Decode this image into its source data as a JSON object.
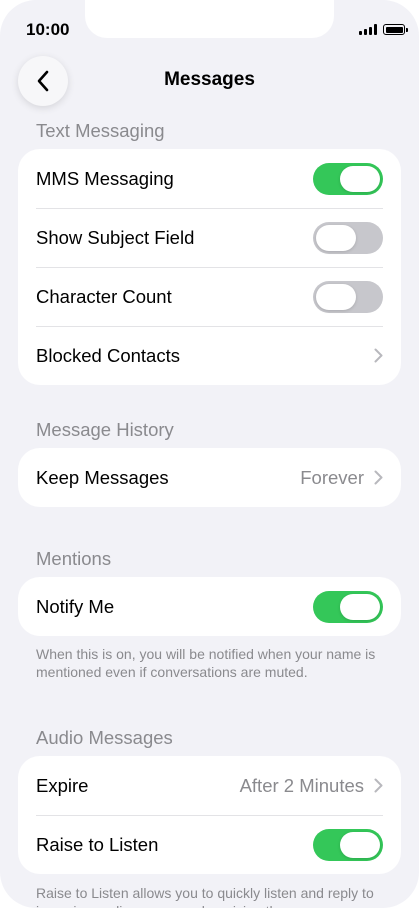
{
  "status_bar": {
    "time": "10:00"
  },
  "nav": {
    "title": "Messages",
    "back_icon": "chevron-left-icon"
  },
  "sections": {
    "text_messaging": {
      "header": "Text Messaging",
      "rows": {
        "mms": {
          "label": "MMS Messaging",
          "toggle": true
        },
        "subject": {
          "label": "Show Subject Field",
          "toggle": false
        },
        "char_count": {
          "label": "Character Count",
          "toggle": false
        },
        "blocked": {
          "label": "Blocked Contacts"
        }
      }
    },
    "message_history": {
      "header": "Message History",
      "rows": {
        "keep": {
          "label": "Keep Messages",
          "value": "Forever"
        }
      }
    },
    "mentions": {
      "header": "Mentions",
      "rows": {
        "notify": {
          "label": "Notify Me",
          "toggle": true
        }
      },
      "footnote": "When this is on, you will be notified when your name is mentioned even if conversations are muted."
    },
    "audio_messages": {
      "header": "Audio Messages",
      "rows": {
        "expire": {
          "label": "Expire",
          "value": "After 2 Minutes"
        },
        "raise": {
          "label": "Raise to Listen",
          "toggle": true
        }
      },
      "footnote": "Raise to Listen allows you to quickly listen and reply to incoming audio messages by raising the"
    }
  },
  "colors": {
    "toggle_on": "#34c759",
    "toggle_off": "#c7c7cc",
    "background": "#f2f2f7",
    "secondary_text": "#8a8a8e"
  }
}
